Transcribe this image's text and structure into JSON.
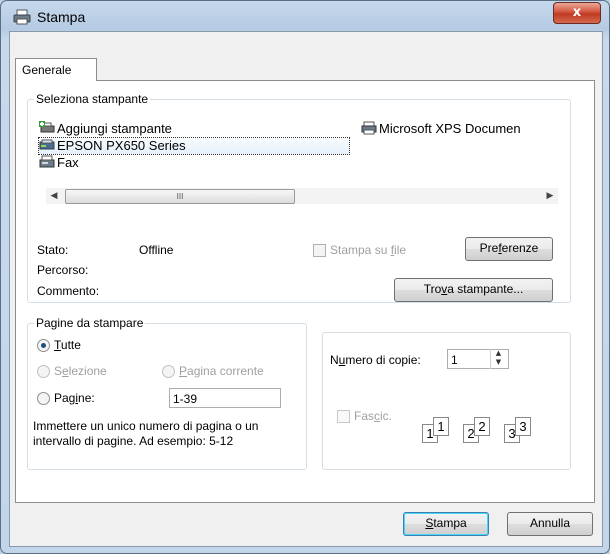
{
  "window": {
    "title": "Stampa",
    "close_label": "x"
  },
  "tabs": [
    {
      "label": "Generale"
    }
  ],
  "select_printer": {
    "group_label": "Seleziona stampante",
    "printers": [
      {
        "label": "Aggiungi stampante",
        "icon": "add-printer-icon"
      },
      {
        "label": "Microsoft XPS Documen",
        "icon": "printer-icon"
      },
      {
        "label": "EPSON PX650 Series",
        "icon": "epson-printer-icon",
        "selected": true
      },
      {
        "label": "Fax",
        "icon": "fax-icon"
      }
    ],
    "scroll_thumb_label": "III",
    "status_label": "Stato:",
    "status_value": "Offline",
    "path_label": "Percorso:",
    "comment_label": "Commento:",
    "print_to_file": {
      "pre": "Stampa su ",
      "key": "f",
      "post": "ile"
    },
    "preferences": {
      "pre": "Pre",
      "key": "f",
      "post": "erenze"
    },
    "find_printer": {
      "pre": "Tro",
      "key": "v",
      "post": "a stampante..."
    }
  },
  "page_range": {
    "group_label": "Pagine da stampare",
    "all": {
      "pre": "",
      "key": "T",
      "post": "utte"
    },
    "selection": {
      "pre": "S",
      "key": "e",
      "post": "lezione"
    },
    "current_page": {
      "pre": "",
      "key": "P",
      "post": "agina corrente"
    },
    "pages": {
      "pre": "Pag",
      "key": "i",
      "post": "ne:"
    },
    "pages_value": "1-39",
    "hint_line1": "Immettere un unico numero di pagina o un",
    "hint_line2": "intervallo di pagine. Ad esempio: 5-12"
  },
  "copies": {
    "label": {
      "pre": "N",
      "key": "u",
      "post": "mero di copie:"
    },
    "value": "1",
    "collate": {
      "pre": "Fas",
      "key": "c",
      "post": "ic."
    },
    "collate_pages": [
      "1",
      "1",
      "2",
      "2",
      "3",
      "3"
    ]
  },
  "footer": {
    "print": {
      "pre": "",
      "key": "S",
      "post": "tampa"
    },
    "cancel": "Annulla"
  },
  "colors": {
    "accent": "#3399ff",
    "disabled": "#a0a0a0",
    "close": "#c7402b"
  }
}
